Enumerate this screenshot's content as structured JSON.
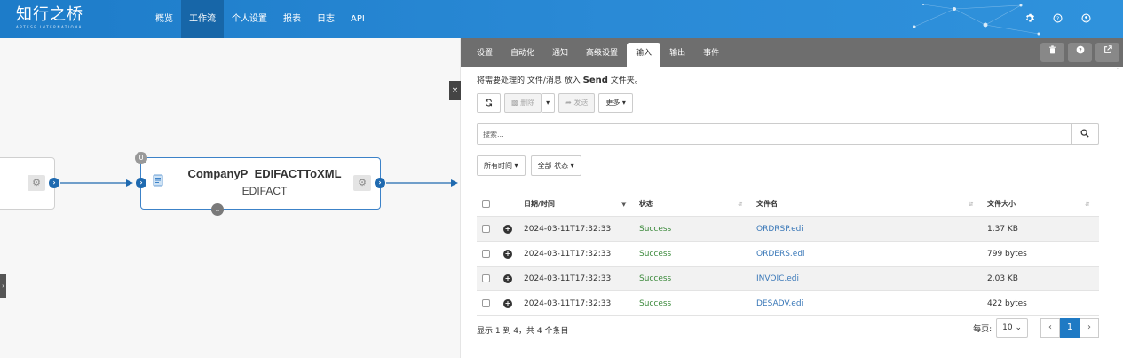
{
  "brand": {
    "logo_main": "知行之桥",
    "logo_sub": "ARTESE INTERNATIONAL"
  },
  "nav": {
    "items": [
      "概览",
      "工作流",
      "个人设置",
      "报表",
      "日志",
      "API"
    ],
    "active_index": 1
  },
  "top_icons": [
    "gear-icon",
    "help-icon",
    "user-icon"
  ],
  "canvas": {
    "node_title": "CompanyP_EDIFACTToXML",
    "node_subtitle": "EDIFACT",
    "badge_count": "0"
  },
  "panel": {
    "tabs": [
      "设置",
      "自动化",
      "通知",
      "高级设置",
      "输入",
      "输出",
      "事件"
    ],
    "active_tab_index": 4,
    "info_prefix": "将需要处理的 文件/消息 放入 ",
    "info_bold": "Send",
    "info_suffix": " 文件夹。",
    "toolbar": {
      "delete_label": "删除",
      "send_label": "发送",
      "more_label": "更多"
    },
    "search_placeholder": "搜索...",
    "filter_time": "所有时间",
    "filter_status": "全部 状态",
    "table": {
      "columns": [
        "日期/时间",
        "状态",
        "文件名",
        "文件大小"
      ],
      "rows": [
        {
          "date": "2024-03-11T17:32:33",
          "status": "Success",
          "file": "ORDRSP.edi",
          "size": "1.37 KB"
        },
        {
          "date": "2024-03-11T17:32:33",
          "status": "Success",
          "file": "ORDERS.edi",
          "size": "799 bytes"
        },
        {
          "date": "2024-03-11T17:32:33",
          "status": "Success",
          "file": "INVOIC.edi",
          "size": "2.03 KB"
        },
        {
          "date": "2024-03-11T17:32:33",
          "status": "Success",
          "file": "DESADV.edi",
          "size": "422 bytes"
        }
      ]
    },
    "footer_info": "显示 1 到 4，共 4 个条目",
    "pager": {
      "per_page_label": "每页:",
      "per_page_value": "10",
      "current_page": "1"
    }
  },
  "colors": {
    "accent": "#1f7ac4",
    "topbar": "#2a8ad6",
    "success": "#3c8a3c",
    "link": "#3a78b8",
    "tabbar": "#6e6e6e"
  }
}
